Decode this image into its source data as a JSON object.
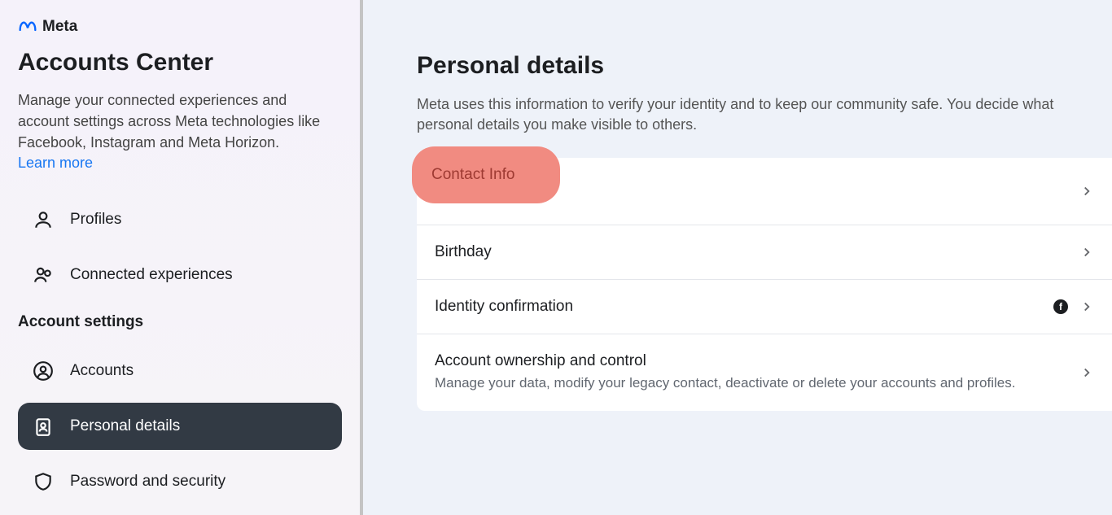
{
  "brand": "Meta",
  "sidebar": {
    "title": "Accounts Center",
    "description": "Manage your connected experiences and account settings across Meta technologies like Facebook, Instagram and Meta Horizon.",
    "learn_more": "Learn more",
    "section_title": "Account settings",
    "items": [
      {
        "label": "Profiles"
      },
      {
        "label": "Connected experiences"
      },
      {
        "label": "Accounts"
      },
      {
        "label": "Personal details"
      },
      {
        "label": "Password and security"
      }
    ]
  },
  "main": {
    "heading": "Personal details",
    "description": "Meta uses this information to verify your identity and to keep our community safe. You decide what personal details you make visible to others.",
    "rows": [
      {
        "title": "Contact Info"
      },
      {
        "title": "Birthday"
      },
      {
        "title": "Identity confirmation"
      },
      {
        "title": "Account ownership and control",
        "sub": "Manage your data, modify your legacy contact, deactivate or delete your accounts and profiles."
      }
    ]
  }
}
